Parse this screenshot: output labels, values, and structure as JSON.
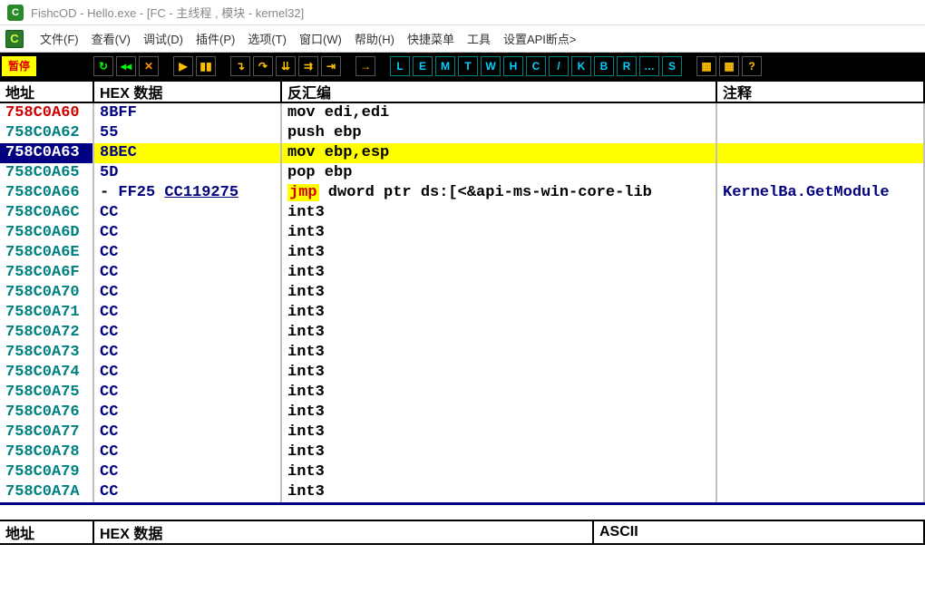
{
  "title": "FishcOD - Hello.exe - [FC - 主线程 , 模块 - kernel32]",
  "app_icon_text": "C",
  "menu": {
    "items": [
      "文件(F)",
      "查看(V)",
      "调试(D)",
      "插件(P)",
      "选项(T)",
      "窗口(W)",
      "帮助(H)",
      "快捷菜单",
      "工具",
      "设置API断点>"
    ]
  },
  "toolbar": {
    "pause": "暂停"
  },
  "headers": {
    "addr": "地址",
    "hex": "HEX 数据",
    "disasm": "反汇编",
    "comment": "注释"
  },
  "rows": [
    {
      "addr": "758C0A60",
      "addr_color": "red",
      "hex": "8BFF",
      "disasm": "mov edi,edi",
      "comment": "",
      "hl": false
    },
    {
      "addr": "758C0A62",
      "addr_color": "",
      "hex": "55",
      "disasm": "push ebp",
      "comment": "",
      "hl": false
    },
    {
      "addr": "758C0A63",
      "addr_color": "",
      "hex": "8BEC",
      "disasm": "mov ebp,esp",
      "comment": "",
      "hl": true
    },
    {
      "addr": "758C0A65",
      "addr_color": "",
      "hex": "5D",
      "disasm": "pop ebp",
      "comment": "",
      "hl": false
    },
    {
      "addr": "758C0A66",
      "addr_color": "",
      "hex_pre": "- FF25 ",
      "hex_link": "CC119275",
      "disasm_jmp": "jmp",
      "disasm_rest": " dword ptr ds:[<&api-ms-win-core-lib",
      "comment": "KernelBa.GetModule",
      "hl": false,
      "is_jmp": true
    },
    {
      "addr": "758C0A6C",
      "addr_color": "",
      "hex": "CC",
      "disasm": "int3",
      "comment": "",
      "hl": false
    },
    {
      "addr": "758C0A6D",
      "addr_color": "",
      "hex": "CC",
      "disasm": "int3",
      "comment": "",
      "hl": false
    },
    {
      "addr": "758C0A6E",
      "addr_color": "",
      "hex": "CC",
      "disasm": "int3",
      "comment": "",
      "hl": false
    },
    {
      "addr": "758C0A6F",
      "addr_color": "",
      "hex": "CC",
      "disasm": "int3",
      "comment": "",
      "hl": false
    },
    {
      "addr": "758C0A70",
      "addr_color": "",
      "hex": "CC",
      "disasm": "int3",
      "comment": "",
      "hl": false
    },
    {
      "addr": "758C0A71",
      "addr_color": "",
      "hex": "CC",
      "disasm": "int3",
      "comment": "",
      "hl": false
    },
    {
      "addr": "758C0A72",
      "addr_color": "",
      "hex": "CC",
      "disasm": "int3",
      "comment": "",
      "hl": false
    },
    {
      "addr": "758C0A73",
      "addr_color": "",
      "hex": "CC",
      "disasm": "int3",
      "comment": "",
      "hl": false
    },
    {
      "addr": "758C0A74",
      "addr_color": "",
      "hex": "CC",
      "disasm": "int3",
      "comment": "",
      "hl": false
    },
    {
      "addr": "758C0A75",
      "addr_color": "",
      "hex": "CC",
      "disasm": "int3",
      "comment": "",
      "hl": false
    },
    {
      "addr": "758C0A76",
      "addr_color": "",
      "hex": "CC",
      "disasm": "int3",
      "comment": "",
      "hl": false
    },
    {
      "addr": "758C0A77",
      "addr_color": "",
      "hex": "CC",
      "disasm": "int3",
      "comment": "",
      "hl": false
    },
    {
      "addr": "758C0A78",
      "addr_color": "",
      "hex": "CC",
      "disasm": "int3",
      "comment": "",
      "hl": false
    },
    {
      "addr": "758C0A79",
      "addr_color": "",
      "hex": "CC",
      "disasm": "int3",
      "comment": "",
      "hl": false
    },
    {
      "addr": "758C0A7A",
      "addr_color": "",
      "hex": "CC",
      "disasm": "int3",
      "comment": "",
      "hl": false
    }
  ],
  "status_line": "",
  "bottom_headers": {
    "addr": "地址",
    "hex": "HEX 数据",
    "ascii": "ASCII"
  }
}
